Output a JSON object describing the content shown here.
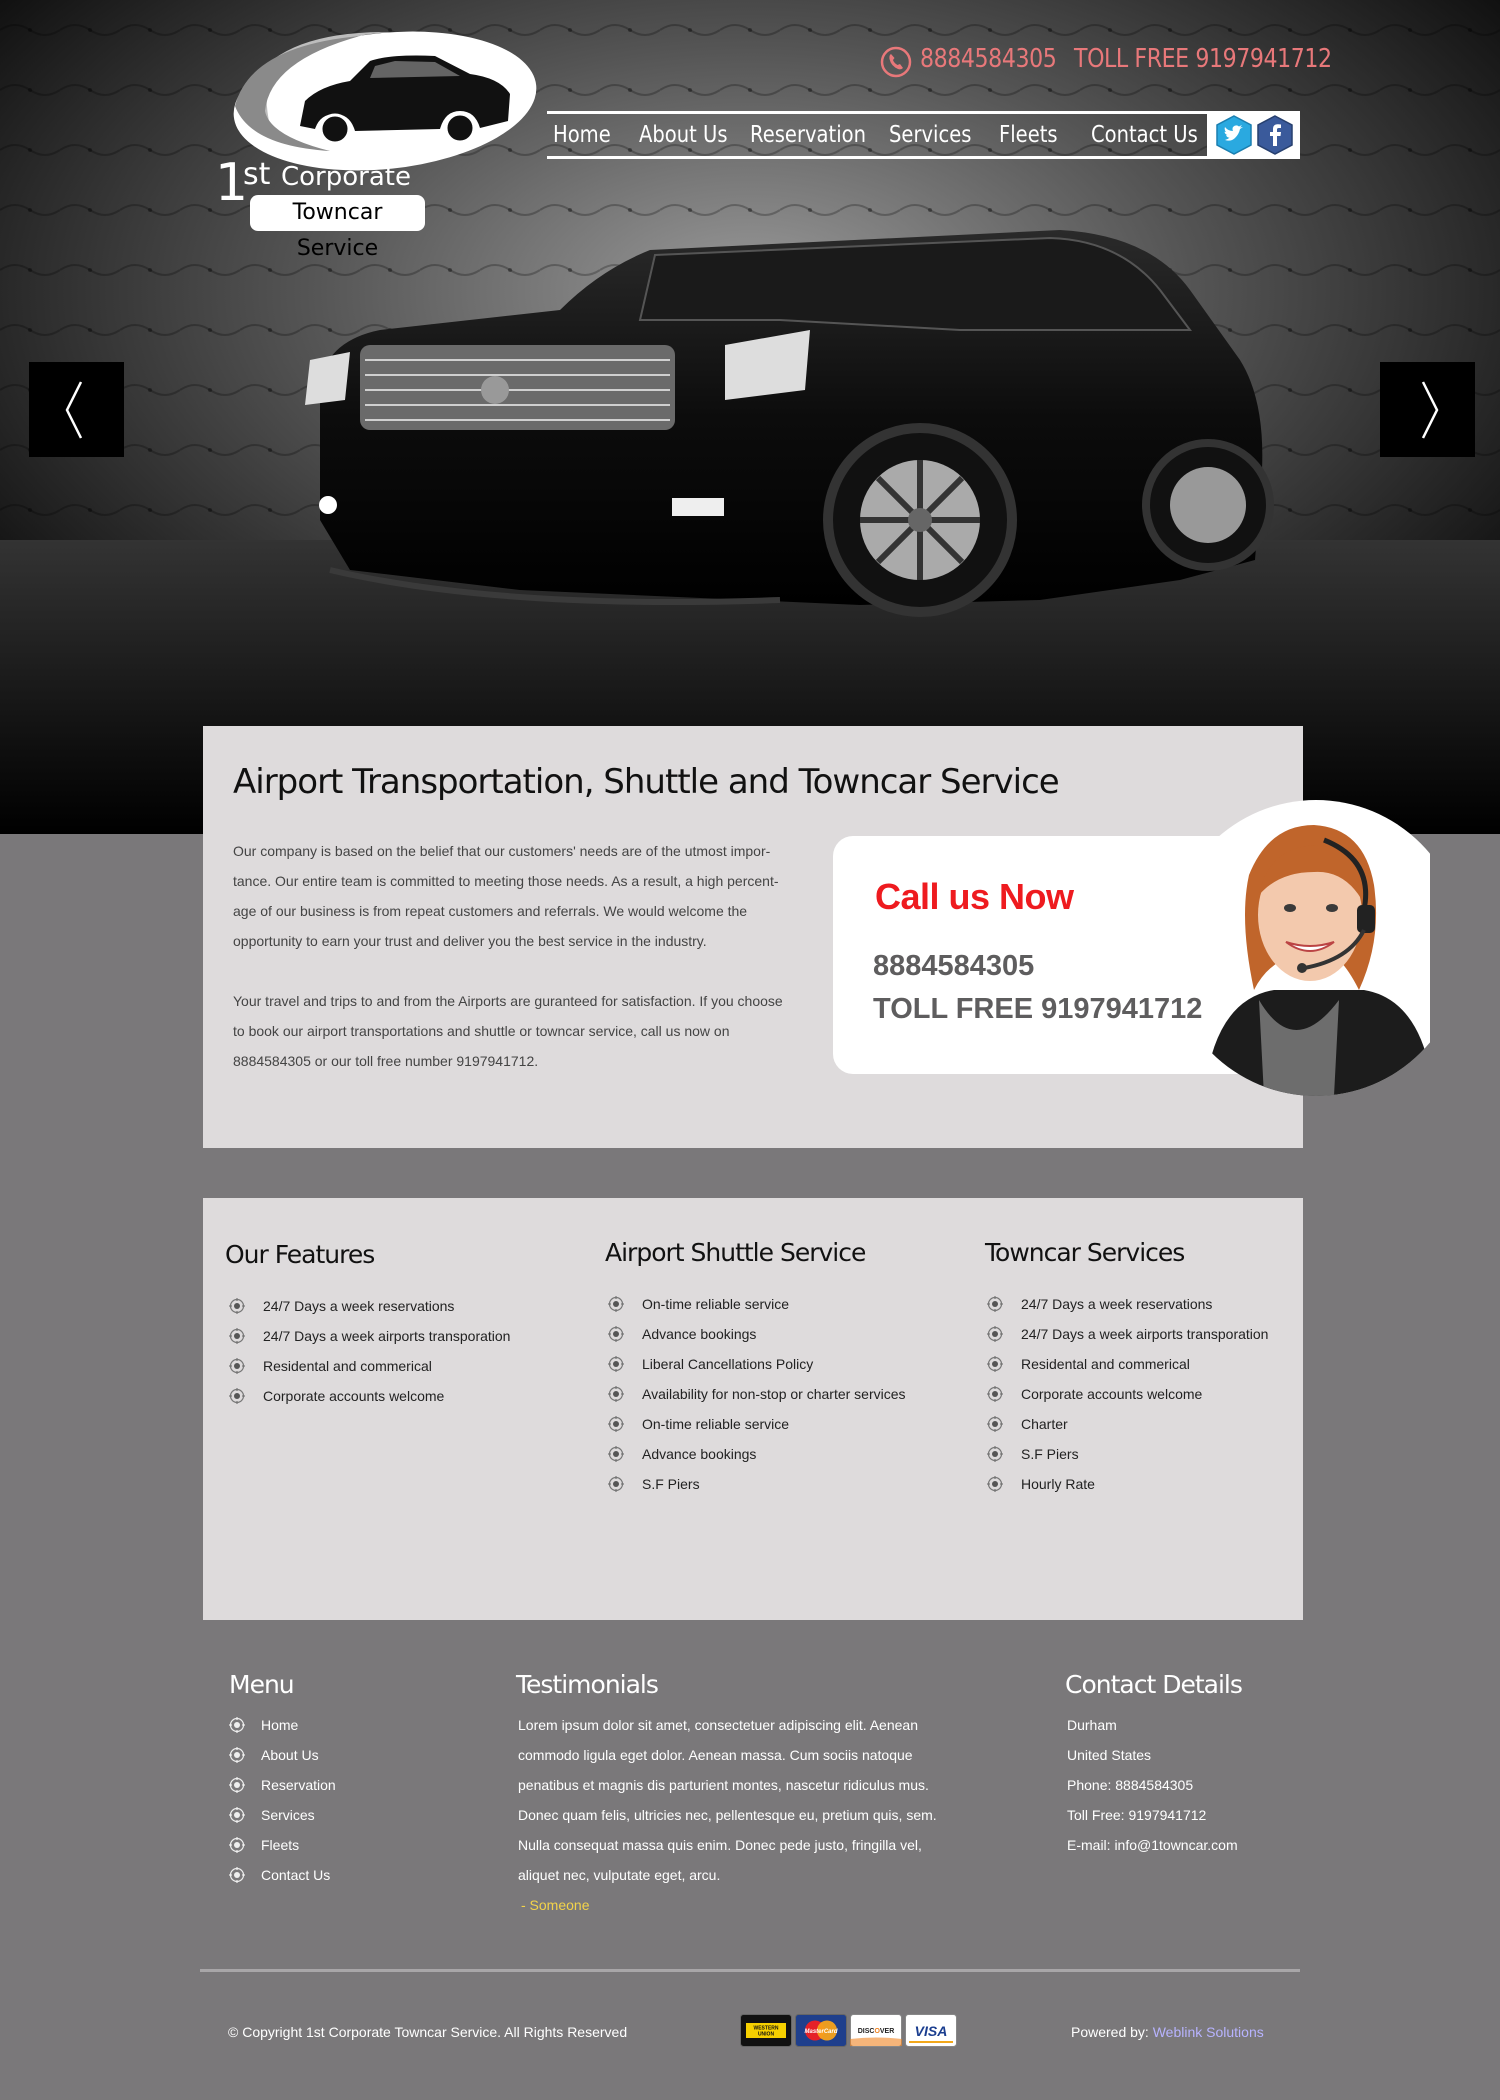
{
  "header": {
    "logo": {
      "ordinal": "1",
      "ordinal_suffix": "st",
      "line1": "Corporate",
      "line2": "Towncar Service"
    },
    "phone": "8884584305",
    "tollfree": "TOLL FREE  9197941712",
    "nav": [
      "Home",
      "About Us",
      "Reservation",
      "Services",
      "Fleets",
      "Contact Us"
    ],
    "social": [
      "twitter-icon",
      "facebook-icon"
    ]
  },
  "intro": {
    "title": "Airport Transportation, Shuttle and Towncar Service",
    "paragraph1": "Our company is based on the belief that our customers' needs are of the utmost impor-tance. Our entire team is committed to meeting those needs. As a result, a high percent-age of our business is from repeat customers and referrals. We would welcome the opportunity to earn your trust and deliver you the best service in the industry.",
    "paragraph2": "Your travel and trips to and from the Airports are guranteed for satisfaction. If you choose to book our airport transportations and shuttle or towncar service, call us now on 8884584305 or our toll free number 9197941712.",
    "call_title": "Call us Now",
    "call_phone": "8884584305",
    "call_tollfree": "TOLL FREE  9197941712"
  },
  "features": {
    "col1": {
      "title": "Our Features",
      "items": [
        "24/7 Days a week reservations",
        "24/7 Days a week airports transporation",
        "Residental and commerical",
        "Corporate accounts welcome"
      ]
    },
    "col2": {
      "title": "Airport Shuttle Service",
      "items": [
        "On-time reliable service",
        "Advance bookings",
        "Liberal Cancellations Policy",
        "Availability for non-stop or charter services",
        "On-time reliable service",
        "Advance bookings",
        "S.F Piers"
      ]
    },
    "col3": {
      "title": "Towncar Services",
      "items": [
        "24/7 Days a week reservations",
        "24/7 Days a week airports transporation",
        "Residental and commerical",
        "Corporate accounts welcome",
        "Charter",
        "S.F Piers",
        "Hourly Rate"
      ]
    }
  },
  "footer": {
    "menu_title": "Menu",
    "menu": [
      "Home",
      "About Us",
      "Reservation",
      "Services",
      "Fleets",
      "Contact Us"
    ],
    "testimonials_title": "Testimonials",
    "testimonial_text": "Lorem ipsum dolor sit amet, consectetuer adipiscing elit. Aenean commodo ligula eget dolor. Aenean massa. Cum sociis natoque penatibus et magnis dis parturient montes, nascetur ridiculus mus. Donec quam felis, ultricies nec, pellentesque eu, pretium quis, sem. Nulla consequat massa quis enim. Donec pede justo, fringilla vel, aliquet nec, vulputate eget, arcu.",
    "testimonial_author": " - Someone",
    "contact_title": "Contact Details",
    "contact": [
      "Durham",
      "United States",
      "Phone: 8884584305",
      "Toll Free:  9197941712",
      "E-mail: info@1towncar.com"
    ],
    "copyright": "© Copyright 1st Corporate Towncar Service. All  Rights Reserved",
    "powered_label": "Powered by: ",
    "powered_link": "Weblink Solutions",
    "payment_cards": [
      {
        "icon": "western-union-icon",
        "text": "WESTERN UNION"
      },
      {
        "icon": "mastercard-icon",
        "text": "MasterCard"
      },
      {
        "icon": "discover-icon",
        "text": "DISCOVER"
      },
      {
        "icon": "visa-icon",
        "text": "VISA"
      }
    ]
  },
  "colors": {
    "accent_header": "#e8787a",
    "call_red": "#ee1b1f",
    "panel": "#dedbdc",
    "page_bg": "#7a787a",
    "author": "#f3d34a",
    "link": "#b7b3ff"
  }
}
